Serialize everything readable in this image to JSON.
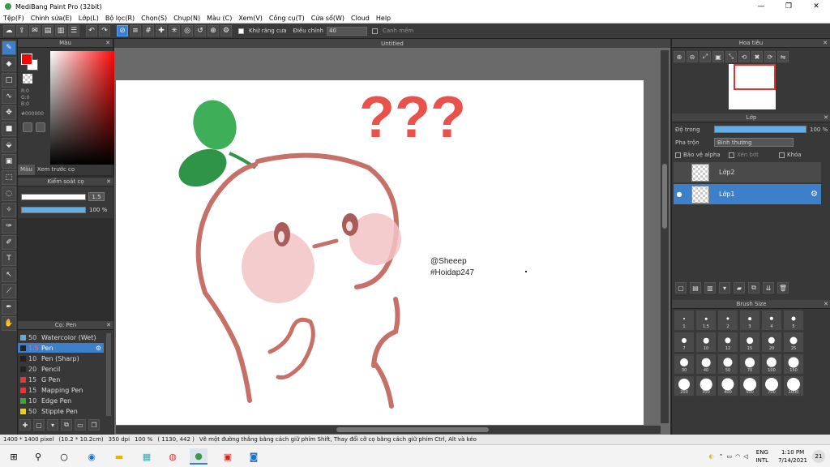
{
  "window": {
    "title": "MediBang Paint Pro (32bit)",
    "minimize": "—",
    "maximize": "❐",
    "close": "✕"
  },
  "menu": [
    "Tệp(F)",
    "Chỉnh sửa(E)",
    "Lớp(L)",
    "Bộ lọc(R)",
    "Chọn(S)",
    "Chụp(N)",
    "Màu (C)",
    "Xem(V)",
    "Công cụ(T)",
    "Cửa sổ(W)",
    "Cloud",
    "Help"
  ],
  "toolbar": {
    "antialias_label": "Khử răng cưa",
    "adjust_label": "Điều chỉnh",
    "adjust_value": "40",
    "snap_label": "Canh mềm"
  },
  "color_panel": {
    "title": "Màu",
    "r": "R:0",
    "g": "G:0",
    "b": "B:0",
    "hex": "#000000",
    "tab_color": "Màu",
    "tab_preview": "Xem trước cọ"
  },
  "brush_control": {
    "title": "Kiểm soát cọ",
    "size_value": "1.5",
    "opacity_value": "100 %"
  },
  "brush_list": {
    "title": "Cọ: Pen",
    "items": [
      {
        "size": "50",
        "name": "Watercolor (Wet)",
        "color": "#66aadd"
      },
      {
        "size": "1.5",
        "name": "Pen",
        "color": "#222222"
      },
      {
        "size": "10",
        "name": "Pen (Sharp)",
        "color": "#222222"
      },
      {
        "size": "20",
        "name": "Pencil",
        "color": "#222222"
      },
      {
        "size": "15",
        "name": "G Pen",
        "color": "#ee3333"
      },
      {
        "size": "15",
        "name": "Mapping Pen",
        "color": "#ee3333"
      },
      {
        "size": "10",
        "name": "Edge Pen",
        "color": "#33aa33"
      },
      {
        "size": "50",
        "name": "Stipple Pen",
        "color": "#eecc22"
      }
    ]
  },
  "document": {
    "tab_title": "Untitled",
    "watermark_line1": "@Sheeep",
    "watermark_line2": "#Hoidap247",
    "question_marks": "???"
  },
  "navigator": {
    "title": "Hoa tiêu"
  },
  "layers": {
    "title": "Lớp",
    "opacity_label": "Độ trong",
    "opacity_value": "100 %",
    "opacity": 1.0,
    "blend_label": "Pha trộn",
    "blend_value": "Bình thường",
    "protect_alpha": "Bảo vệ alpha",
    "clipping": "Xén bớt",
    "lock": "Khóa",
    "items": [
      {
        "name": "Lớp2",
        "selected": false
      },
      {
        "name": "Lớp1",
        "selected": true
      }
    ]
  },
  "brush_size_panel": {
    "title": "Brush Size",
    "sizes": [
      "1",
      "1.5",
      "2",
      "3",
      "4",
      "5",
      "7",
      "10",
      "12",
      "15",
      "20",
      "25",
      "30",
      "40",
      "50",
      "70",
      "100",
      "150",
      "200",
      "300",
      "400",
      "500",
      "700",
      "1000"
    ]
  },
  "status": {
    "dims": "1400 * 1400 pixel",
    "cm": "(10.2 * 10.2cm)",
    "dpi": "350 dpi",
    "zoom": "100 %",
    "coords": "( 1130, 442 )",
    "hint": "Vẽ một đường thẳng bằng cách giữ phím Shift, Thay đổi cỡ cọ bằng cách giữ phím Ctrl, Alt và kéo"
  },
  "taskbar": {
    "lang1": "ENG",
    "lang2": "INTL",
    "time": "1:10 PM",
    "date": "7/14/2021",
    "notif": "21"
  }
}
